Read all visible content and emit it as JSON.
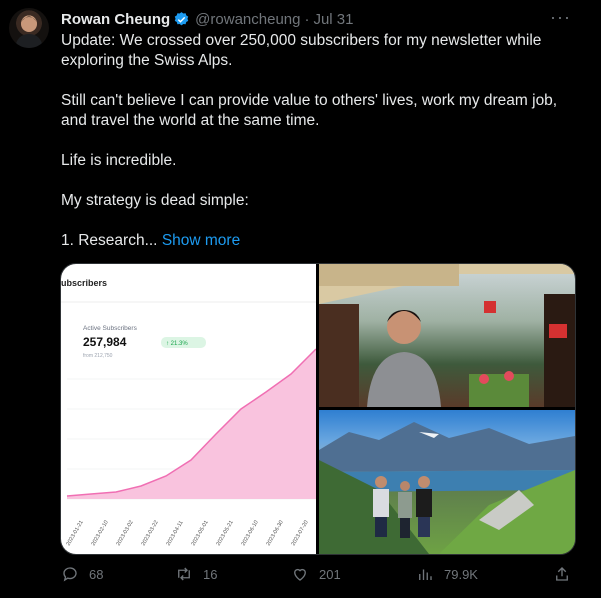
{
  "author": {
    "name": "Rowan Cheung",
    "handle": "@rowancheung",
    "time": "Jul 31",
    "verified": true
  },
  "body": {
    "p1": "Update: We crossed over 250,000 subscribers for my newsletter while exploring the Swiss Alps.",
    "p2": "Still can't believe I can provide value to others' lives, work my dream job, and travel the world at the same time.",
    "p3": "Life is incredible.",
    "p4": "My strategy is dead simple:",
    "p5": "1. Research...",
    "show_more": "Show more"
  },
  "chart": {
    "header": "ubscribers",
    "label": "Active Subscribers",
    "value": "257,984",
    "change": "↑ 21.3%",
    "from": "from 212,750",
    "dates": [
      "2023-01-21",
      "2023-02-10",
      "2023-03-02",
      "2023-03-22",
      "2023-04-11",
      "2023-05-01",
      "2023-05-21",
      "2023-06-10",
      "2023-06-30",
      "2023-07-20"
    ]
  },
  "actions": {
    "replies": "68",
    "reposts": "16",
    "likes": "201",
    "views": "79.9K"
  },
  "colors": {
    "accent": "#1d9bf0",
    "muted": "#71767b",
    "chart_pink": "#f06fb3"
  }
}
